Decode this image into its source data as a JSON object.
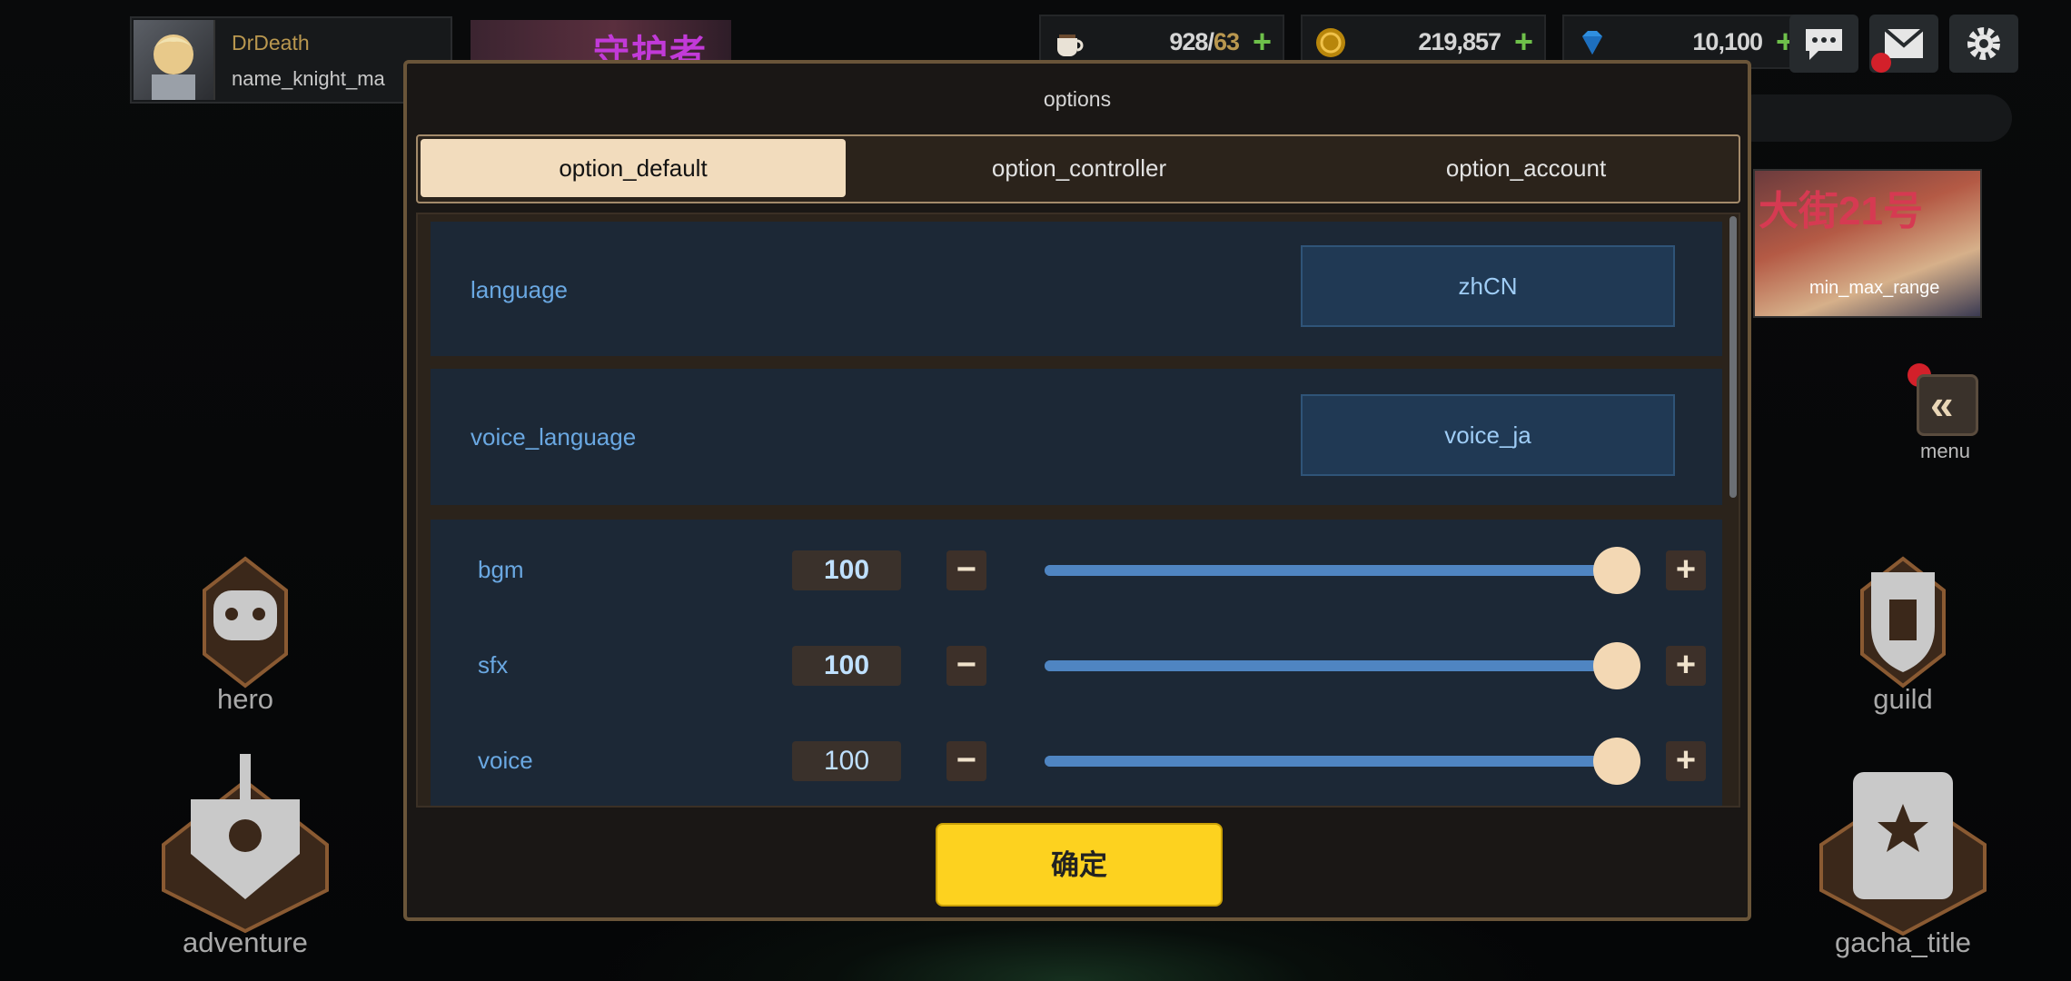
{
  "profile": {
    "name": "DrDeath",
    "subtitle": "name_knight_ma"
  },
  "top_banner": {
    "text": "守护者"
  },
  "resources": [
    {
      "icon": "coffee-icon",
      "value": "928/",
      "cap": "63"
    },
    {
      "icon": "gold-coin-icon",
      "value": "219,857",
      "cap": ""
    },
    {
      "icon": "gem-icon",
      "value": "10,100",
      "cap": ""
    }
  ],
  "plus_label": "+",
  "right_banner": {
    "title": "大街21号",
    "caption": "min_max_range"
  },
  "menu": {
    "label": "menu",
    "chevron": "«"
  },
  "side_nav": {
    "hero": "hero",
    "adventure": "adventure",
    "guild": "guild",
    "gacha": "gacha_title"
  },
  "modal": {
    "title": "options",
    "tabs": [
      {
        "label": "option_default",
        "active": true
      },
      {
        "label": "option_controller",
        "active": false
      },
      {
        "label": "option_account",
        "active": false
      }
    ],
    "language": {
      "label": "language",
      "value": "zhCN"
    },
    "voice_language": {
      "label": "voice_language",
      "value": "voice_ja"
    },
    "volumes": [
      {
        "label": "bgm",
        "value": "100",
        "level": 1.0
      },
      {
        "label": "sfx",
        "value": "100",
        "level": 1.0
      },
      {
        "label": "voice",
        "value": "100",
        "level": 1.0
      }
    ],
    "minus": "−",
    "plus": "+",
    "confirm": "确定"
  },
  "colors": {
    "accent_yellow": "#fdd21f",
    "slider_blue": "#4f85c2",
    "label_blue": "#6aa8e2",
    "gold_text": "#b9974f"
  }
}
